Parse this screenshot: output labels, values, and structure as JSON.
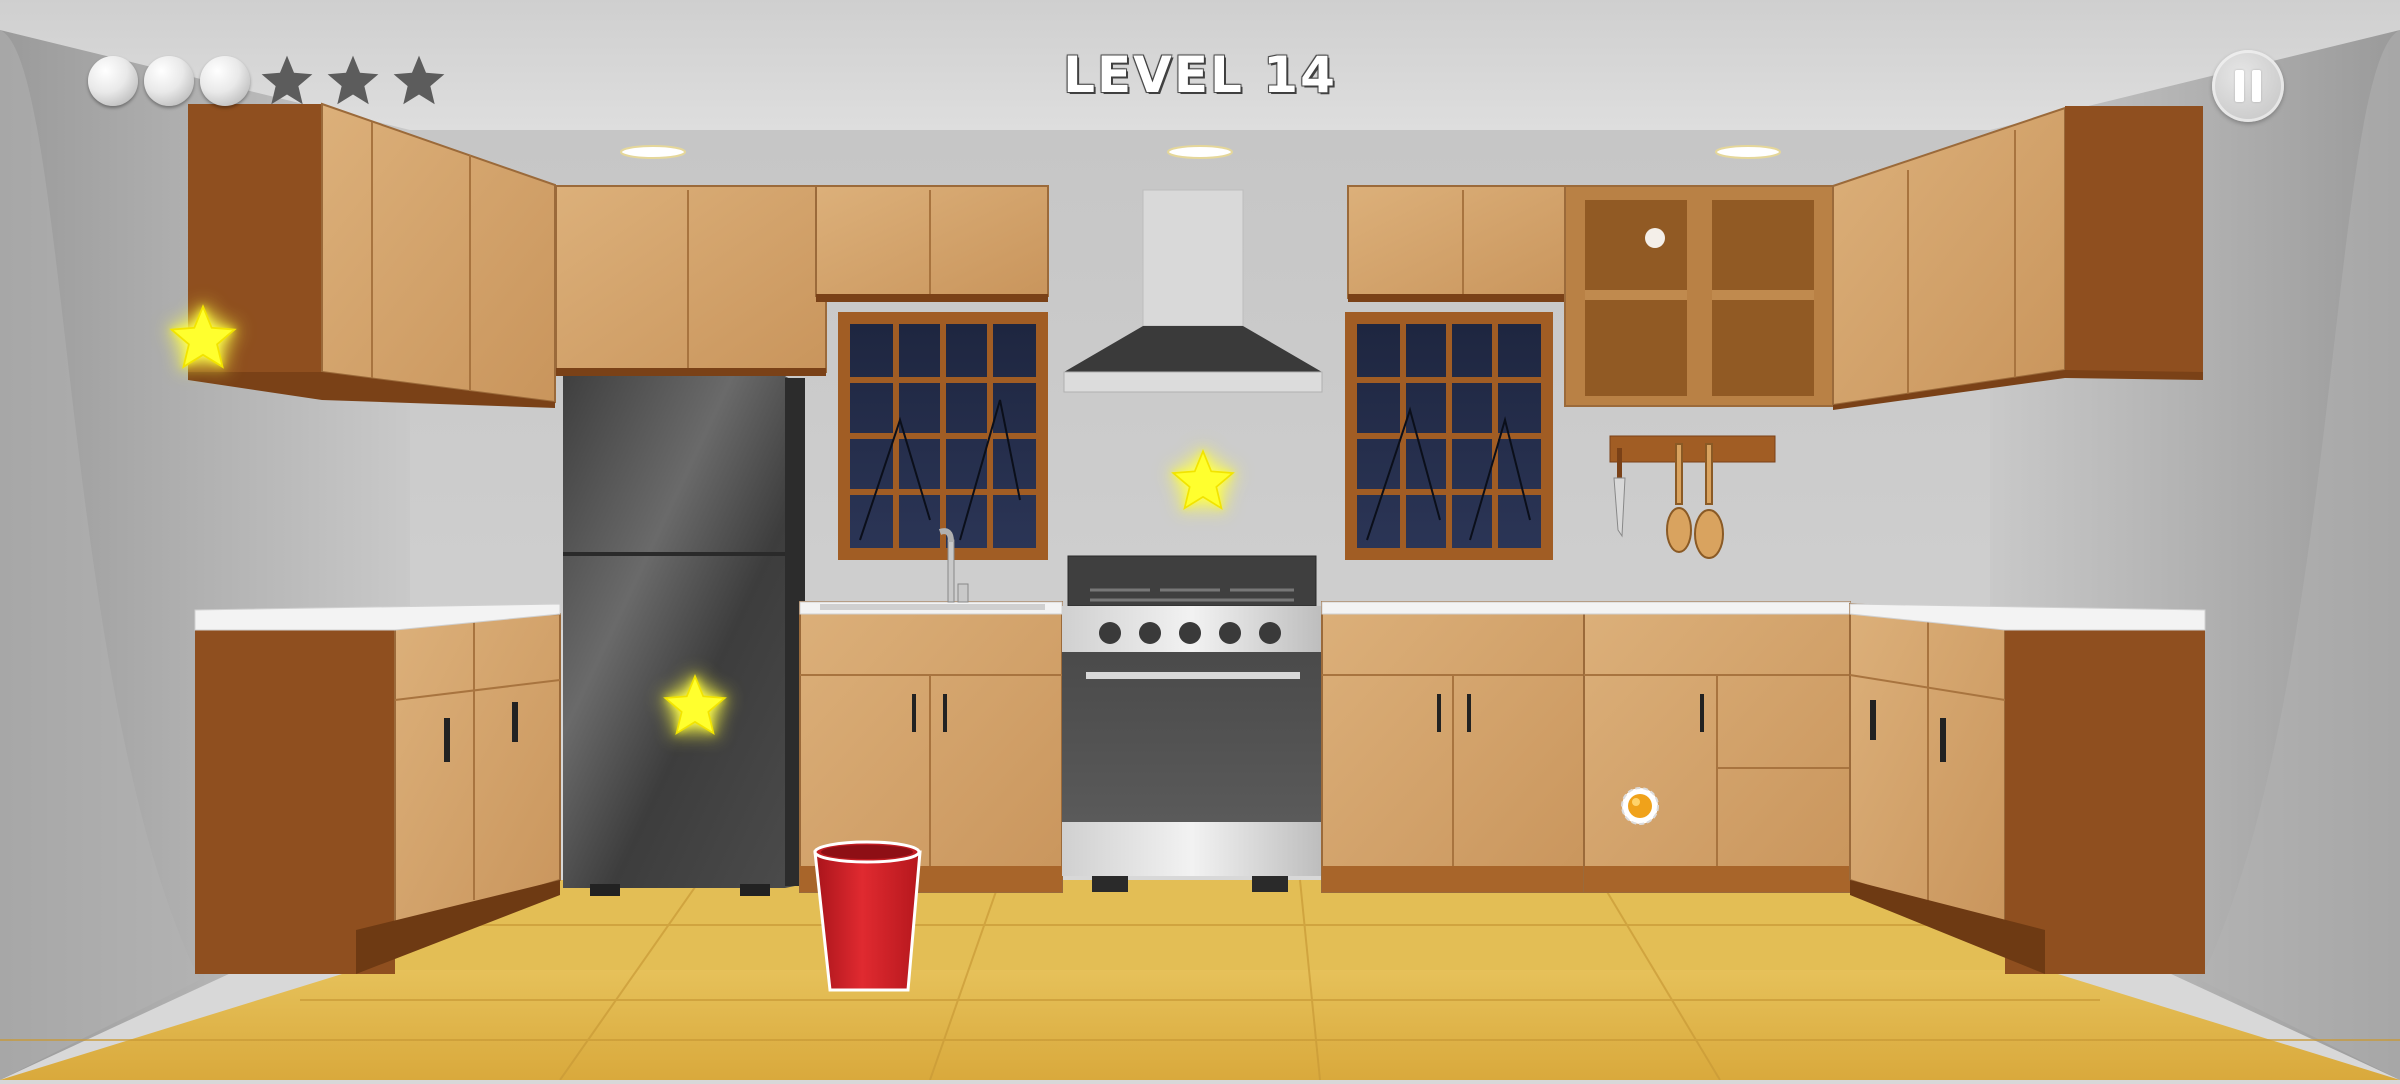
{
  "hud": {
    "level_label": "LEVEL 14",
    "balls_total": 3,
    "stars_collected": 0,
    "stars_total": 3,
    "pause_icon": "pause-icon"
  },
  "colors": {
    "cabinet_light": "#d8a96f",
    "cabinet_dark": "#8a4c1e",
    "countertop": "#f3f3f3",
    "wall": "#c9c9c9",
    "floor": "#e0b64a",
    "fridge": "#4b4b4b",
    "cup": "#d21f26",
    "star": "#ffff3a"
  },
  "scene": {
    "objects": [
      "refrigerator",
      "sink",
      "range-hood",
      "stove",
      "window-left",
      "window-right",
      "utensil-rack",
      "red-cup",
      "upper-cabinets",
      "lower-cabinets",
      "open-shelf-cabinet"
    ],
    "collectible_stars": 3,
    "target": "red-cup"
  }
}
